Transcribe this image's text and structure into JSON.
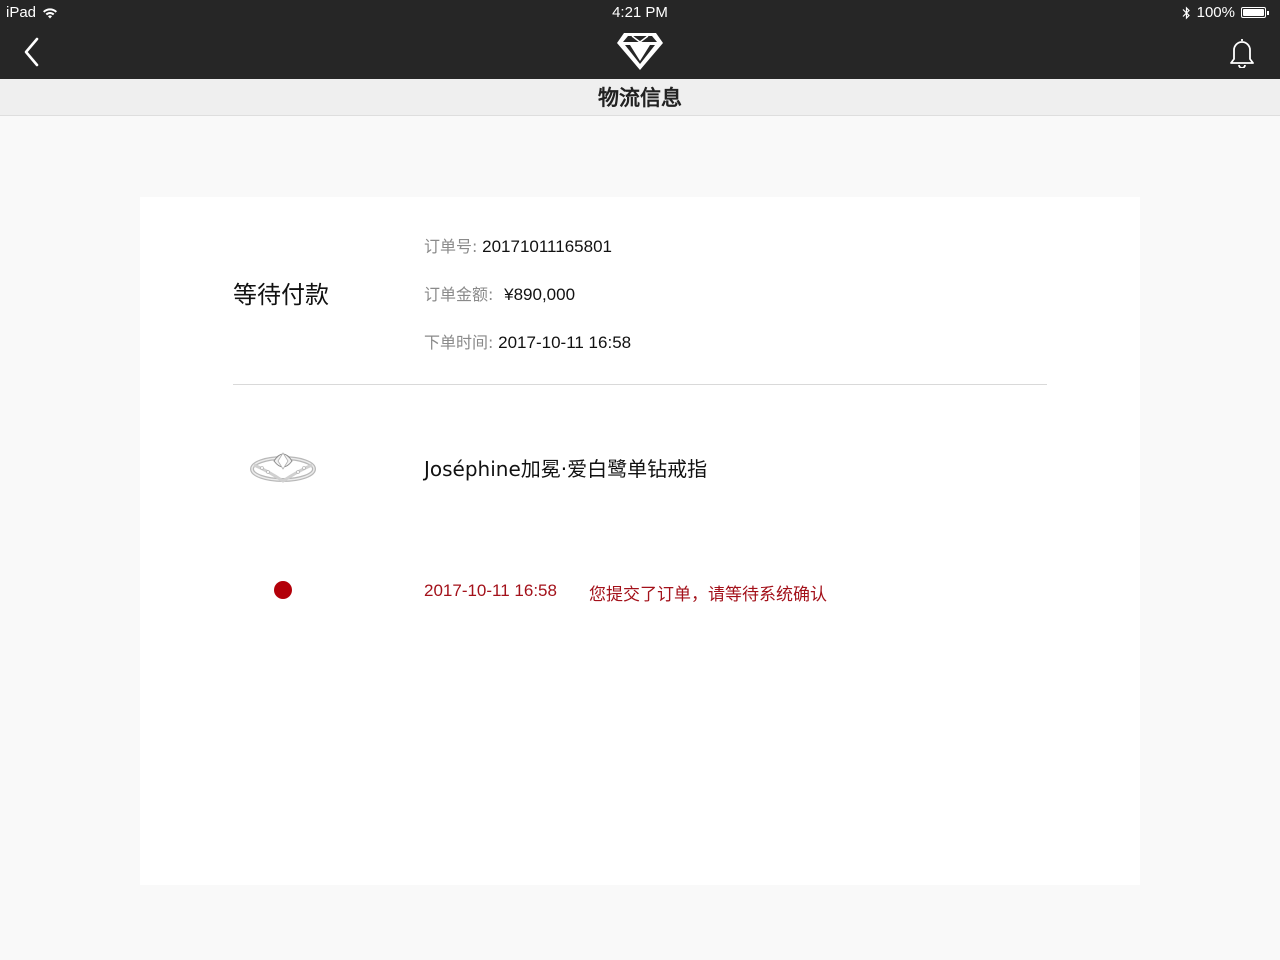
{
  "status_bar": {
    "device": "iPad",
    "time": "4:21 PM",
    "battery": "100%"
  },
  "nav": {
    "back_icon": "chevron-left-icon",
    "logo_icon": "diamond-icon",
    "notification_icon": "bell-icon"
  },
  "page_title": "物流信息",
  "order": {
    "status": "等待付款",
    "number_label": "订单号:",
    "number": "20171011165801",
    "amount_label": "订单金额:",
    "amount": "¥890,000",
    "time_label": "下单时间:",
    "time": "2017-10-11 16:58"
  },
  "product": {
    "name": "Joséphine加冕·爱白鹭单钻戒指"
  },
  "timeline": [
    {
      "time": "2017-10-11 16:58",
      "message": "您提交了订单，请等待系统确认",
      "color": "#b30009"
    }
  ]
}
